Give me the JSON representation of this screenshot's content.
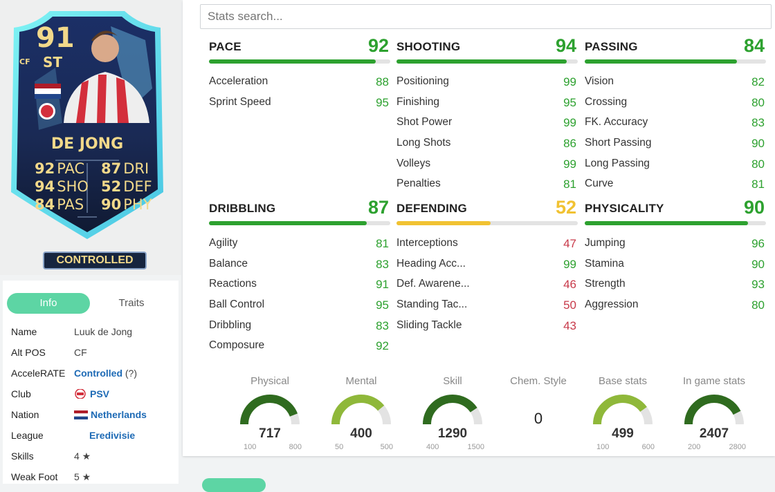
{
  "card": {
    "rating": "91",
    "position": "ST",
    "alt_position": "CF",
    "name": "DE JONG",
    "stats_left": [
      {
        "value": "92",
        "label": "PAC"
      },
      {
        "value": "94",
        "label": "SHO"
      },
      {
        "value": "84",
        "label": "PAS"
      }
    ],
    "stats_right": [
      {
        "value": "87",
        "label": "DRI"
      },
      {
        "value": "52",
        "label": "DEF"
      },
      {
        "value": "90",
        "label": "PHY"
      }
    ],
    "badge": "CONTROLLED"
  },
  "info": {
    "tabs": [
      "Info",
      "Traits"
    ],
    "rows": [
      {
        "key": "Name",
        "value": "Luuk de Jong"
      },
      {
        "key": "Alt POS",
        "value": "CF"
      },
      {
        "key": "AcceleRATE",
        "value": "Controlled",
        "suffix": " (?)"
      },
      {
        "key": "Club",
        "value": "PSV"
      },
      {
        "key": "Nation",
        "value": "Netherlands"
      },
      {
        "key": "League",
        "value": "Eredivisie"
      },
      {
        "key": "Skills",
        "value": "4 ★"
      },
      {
        "key": "Weak Foot",
        "value": "5 ★"
      }
    ]
  },
  "search": {
    "placeholder": "Stats search..."
  },
  "categories": [
    {
      "name": "PACE",
      "value": "92",
      "bar_pct": 92,
      "color": "green",
      "stats": [
        {
          "name": "Acceleration",
          "value": "88",
          "color": "green"
        },
        {
          "name": "Sprint Speed",
          "value": "95",
          "color": "green"
        }
      ]
    },
    {
      "name": "SHOOTING",
      "value": "94",
      "bar_pct": 94,
      "color": "green",
      "stats": [
        {
          "name": "Positioning",
          "value": "99",
          "color": "green"
        },
        {
          "name": "Finishing",
          "value": "95",
          "color": "green"
        },
        {
          "name": "Shot Power",
          "value": "99",
          "color": "green"
        },
        {
          "name": "Long Shots",
          "value": "86",
          "color": "green"
        },
        {
          "name": "Volleys",
          "value": "99",
          "color": "green"
        },
        {
          "name": "Penalties",
          "value": "81",
          "color": "green"
        }
      ]
    },
    {
      "name": "PASSING",
      "value": "84",
      "bar_pct": 84,
      "color": "green",
      "stats": [
        {
          "name": "Vision",
          "value": "82",
          "color": "green"
        },
        {
          "name": "Crossing",
          "value": "80",
          "color": "green"
        },
        {
          "name": "FK. Accuracy",
          "value": "83",
          "color": "green"
        },
        {
          "name": "Short Passing",
          "value": "90",
          "color": "green"
        },
        {
          "name": "Long Passing",
          "value": "80",
          "color": "green"
        },
        {
          "name": "Curve",
          "value": "81",
          "color": "green"
        }
      ]
    },
    {
      "name": "DRIBBLING",
      "value": "87",
      "bar_pct": 87,
      "color": "green",
      "stats": [
        {
          "name": "Agility",
          "value": "81",
          "color": "green"
        },
        {
          "name": "Balance",
          "value": "83",
          "color": "green"
        },
        {
          "name": "Reactions",
          "value": "91",
          "color": "green"
        },
        {
          "name": "Ball Control",
          "value": "95",
          "color": "green"
        },
        {
          "name": "Dribbling",
          "value": "83",
          "color": "green"
        },
        {
          "name": "Composure",
          "value": "92",
          "color": "green"
        }
      ]
    },
    {
      "name": "DEFENDING",
      "value": "52",
      "bar_pct": 52,
      "color": "yellow",
      "stats": [
        {
          "name": "Interceptions",
          "value": "47",
          "color": "red"
        },
        {
          "name": "Heading Acc...",
          "value": "99",
          "color": "green"
        },
        {
          "name": "Def. Awarene...",
          "value": "46",
          "color": "red"
        },
        {
          "name": "Standing Tac...",
          "value": "50",
          "color": "red"
        },
        {
          "name": "Sliding Tackle",
          "value": "43",
          "color": "red"
        }
      ]
    },
    {
      "name": "PHYSICALITY",
      "value": "90",
      "bar_pct": 90,
      "color": "green",
      "stats": [
        {
          "name": "Jumping",
          "value": "96",
          "color": "green"
        },
        {
          "name": "Stamina",
          "value": "90",
          "color": "green"
        },
        {
          "name": "Strength",
          "value": "93",
          "color": "green"
        },
        {
          "name": "Aggression",
          "value": "80",
          "color": "green"
        }
      ]
    }
  ],
  "summary": [
    {
      "title": "Physical",
      "value": "717",
      "min": "100",
      "max": "800",
      "fraction": 0.88,
      "color": "#2f6b1f"
    },
    {
      "title": "Mental",
      "value": "400",
      "min": "50",
      "max": "500",
      "fraction": 0.78,
      "color": "#8fb83a"
    },
    {
      "title": "Skill",
      "value": "1290",
      "min": "400",
      "max": "1500",
      "fraction": 0.81,
      "color": "#2f6b1f"
    },
    {
      "title": "Chem. Style",
      "value": "0"
    },
    {
      "title": "Base stats",
      "value": "499",
      "min": "100",
      "max": "600",
      "fraction": 0.8,
      "color": "#8fb83a"
    },
    {
      "title": "In game stats",
      "value": "2407",
      "min": "200",
      "max": "2800",
      "fraction": 0.85,
      "color": "#2f6b1f"
    }
  ],
  "colors": {
    "green": "#2da12f",
    "yellow": "#f1c232",
    "red": "#c83a4a",
    "accent": "#5dd5a4",
    "link": "#1d6ab5"
  }
}
